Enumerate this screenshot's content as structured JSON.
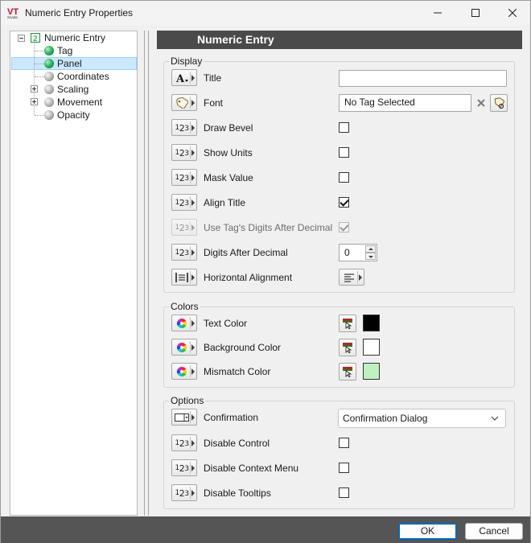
{
  "window": {
    "title": "Numeric Entry Properties",
    "logo_text": "VT",
    "logo_subtext": "Scada",
    "controls": [
      "minimize",
      "maximize",
      "close"
    ]
  },
  "tree": {
    "root": "Numeric Entry",
    "items": [
      {
        "label": "Tag",
        "icon": "green-ball-icon"
      },
      {
        "label": "Panel",
        "icon": "green-ball-icon",
        "selected": true
      },
      {
        "label": "Coordinates",
        "icon": "gray-ball-icon"
      },
      {
        "label": "Scaling",
        "icon": "gray-ball-icon",
        "expandable": true
      },
      {
        "label": "Movement",
        "icon": "gray-ball-icon",
        "expandable": true
      },
      {
        "label": "Opacity",
        "icon": "gray-ball-icon"
      }
    ]
  },
  "panel": {
    "header": "Numeric Entry",
    "display": {
      "group_label": "Display",
      "title_label": "Title",
      "title_value": "",
      "font_label": "Font",
      "font_value": "No Tag Selected",
      "draw_bevel_label": "Draw Bevel",
      "draw_bevel": false,
      "show_units_label": "Show Units",
      "show_units": false,
      "mask_value_label": "Mask Value",
      "mask_value": false,
      "align_title_label": "Align Title",
      "align_title": true,
      "use_tag_digits_label": "Use Tag's Digits After Decimal",
      "use_tag_digits": true,
      "digits_label": "Digits After Decimal",
      "digits_value": "0",
      "halign_label": "Horizontal Alignment",
      "halign_value": "left"
    },
    "colors": {
      "group_label": "Colors",
      "text_color_label": "Text Color",
      "text_color": "#000000",
      "background_color_label": "Background Color",
      "background_color": "#ffffff",
      "mismatch_color_label": "Mismatch Color",
      "mismatch_color": "#c0f0c0"
    },
    "options": {
      "group_label": "Options",
      "confirmation_label": "Confirmation",
      "confirmation_value": "Confirmation Dialog",
      "disable_control_label": "Disable Control",
      "disable_control": false,
      "disable_context_menu_label": "Disable Context Menu",
      "disable_context_menu": false,
      "disable_tooltips_label": "Disable Tooltips",
      "disable_tooltips": false
    }
  },
  "footer": {
    "ok_label": "OK",
    "cancel_label": "Cancel"
  }
}
